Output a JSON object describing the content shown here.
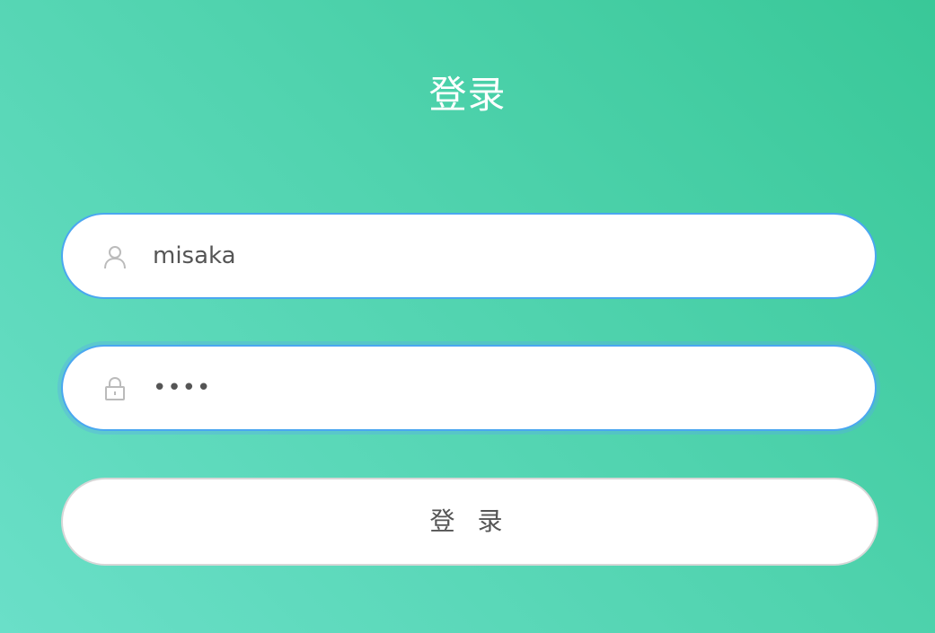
{
  "page": {
    "title": "登录"
  },
  "form": {
    "username": {
      "value": "misaka",
      "icon": "user-icon"
    },
    "password": {
      "value": "••••",
      "icon": "lock-icon"
    },
    "submit_label": "登 录"
  },
  "colors": {
    "background_start": "#39c898",
    "background_end": "#6adfc8",
    "field_border": "#4aa7f0",
    "icon": "#bbbbbb",
    "text": "#555555"
  }
}
